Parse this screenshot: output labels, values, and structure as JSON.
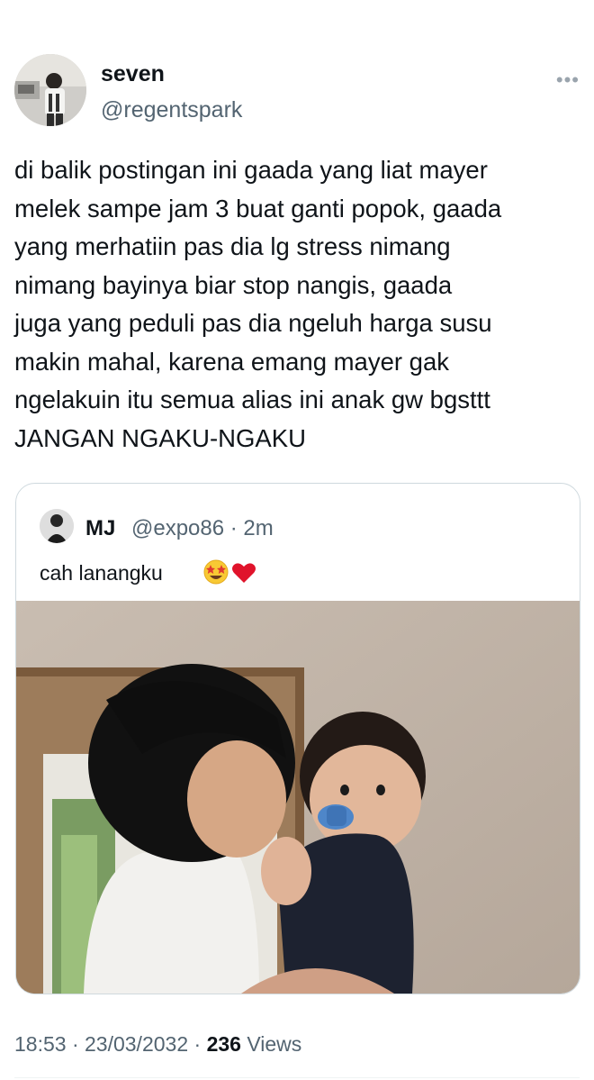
{
  "author": {
    "name": "seven",
    "handle": "@regentspark",
    "more_icon": "ellipsis-icon"
  },
  "tweet": {
    "text": "di balik postingan ini gaada yang liat mayer\nmelek sampe jam 3 buat ganti popok, gaada\nyang merhatiin pas dia lg stress nimang\nnimang bayinya biar stop nangis, gaada\njuga yang peduli pas dia ngeluh harga susu\nmakin mahal, karena emang mayer gak\nngelakuin itu semua alias ini anak gw bgsttt\nJANGAN NGAKU-NGAKU"
  },
  "quoted": {
    "name": "MJ",
    "handle": "@expo86 · 2m",
    "text": "cah lanangku",
    "emojis": [
      "star-struck-emoji",
      "red-heart-emoji"
    ]
  },
  "meta": {
    "time": "18:53 · 23/03/2032 · ",
    "views_count": "236",
    "views_label": " Views"
  },
  "colors": {
    "text": "#0f1419",
    "secondary": "#536471",
    "border": "#cfd9de"
  }
}
